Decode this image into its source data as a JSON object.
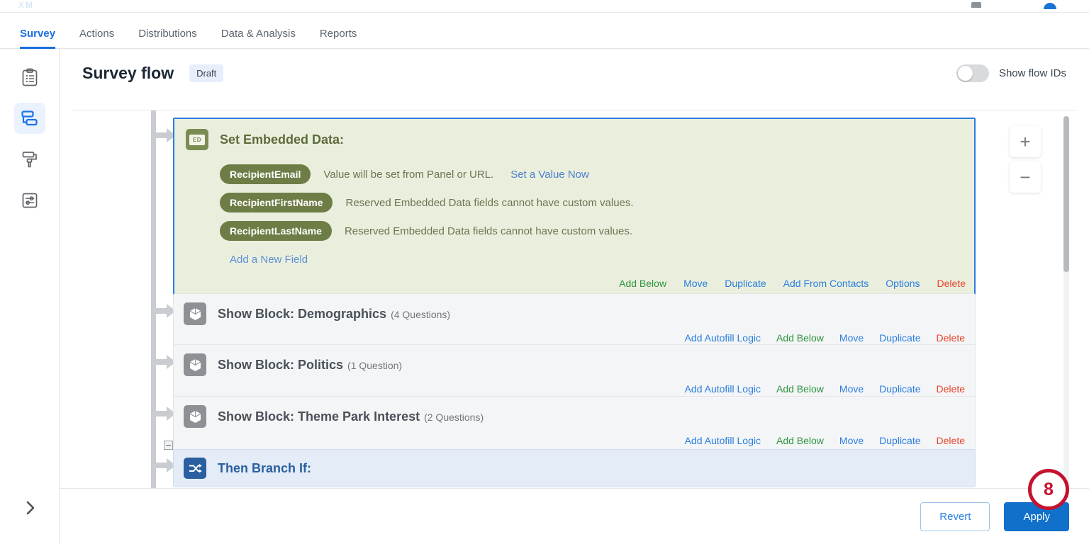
{
  "topbar": {
    "logo": "XM",
    "icon": "grid-icon",
    "avatar": "user-avatar"
  },
  "tabs": [
    {
      "label": "Survey",
      "active": true
    },
    {
      "label": "Actions",
      "active": false
    },
    {
      "label": "Distributions",
      "active": false
    },
    {
      "label": "Data & Analysis",
      "active": false
    },
    {
      "label": "Reports",
      "active": false
    }
  ],
  "rail": [
    {
      "name": "survey-builder-icon",
      "active": false
    },
    {
      "name": "survey-flow-icon",
      "active": true
    },
    {
      "name": "look-and-feel-icon",
      "active": false
    },
    {
      "name": "survey-options-icon",
      "active": false
    }
  ],
  "rail_expand": "chevron-right-icon",
  "header": {
    "title": "Survey flow",
    "badge": "Draft",
    "toggle_label": "Show flow IDs",
    "toggle_on": false
  },
  "zoom_controls": {
    "in": "+",
    "out": "−"
  },
  "flow": {
    "embedded_data": {
      "icon_text": "ED",
      "title": "Set Embedded Data:",
      "fields": [
        {
          "name": "RecipientEmail",
          "note": "Value will be set from Panel or URL.",
          "link": "Set a Value Now"
        },
        {
          "name": "RecipientFirstName",
          "note": "Reserved Embedded Data fields cannot have custom values.",
          "link": ""
        },
        {
          "name": "RecipientLastName",
          "note": "Reserved Embedded Data fields cannot have custom values.",
          "link": ""
        }
      ],
      "add_field": "Add a New Field",
      "actions": [
        {
          "label": "Add Below",
          "color": "green"
        },
        {
          "label": "Move",
          "color": "blue"
        },
        {
          "label": "Duplicate",
          "color": "blue"
        },
        {
          "label": "Add From Contacts",
          "color": "blue"
        },
        {
          "label": "Options",
          "color": "blue"
        },
        {
          "label": "Delete",
          "color": "red"
        }
      ]
    },
    "blocks": [
      {
        "prefix": "Show Block: ",
        "title": "Demographics",
        "count": "(4 Questions)",
        "actions": [
          {
            "label": "Add Autofill Logic",
            "color": "blue"
          },
          {
            "label": "Add Below",
            "color": "green"
          },
          {
            "label": "Move",
            "color": "blue"
          },
          {
            "label": "Duplicate",
            "color": "blue"
          },
          {
            "label": "Delete",
            "color": "red"
          }
        ]
      },
      {
        "prefix": "Show Block: ",
        "title": "Politics",
        "count": "(1 Question)",
        "actions": [
          {
            "label": "Add Autofill Logic",
            "color": "blue"
          },
          {
            "label": "Add Below",
            "color": "green"
          },
          {
            "label": "Move",
            "color": "blue"
          },
          {
            "label": "Duplicate",
            "color": "blue"
          },
          {
            "label": "Delete",
            "color": "red"
          }
        ]
      },
      {
        "prefix": "Show Block: ",
        "title": "Theme Park Interest",
        "count": "(2 Questions)",
        "actions": [
          {
            "label": "Add Autofill Logic",
            "color": "blue"
          },
          {
            "label": "Add Below",
            "color": "green"
          },
          {
            "label": "Move",
            "color": "blue"
          },
          {
            "label": "Duplicate",
            "color": "blue"
          },
          {
            "label": "Delete",
            "color": "red"
          }
        ]
      }
    ],
    "branch": {
      "title": "Then Branch If:"
    }
  },
  "footer": {
    "revert": "Revert",
    "apply": "Apply"
  },
  "annotation": {
    "number": "8",
    "color": "#c4122f"
  }
}
